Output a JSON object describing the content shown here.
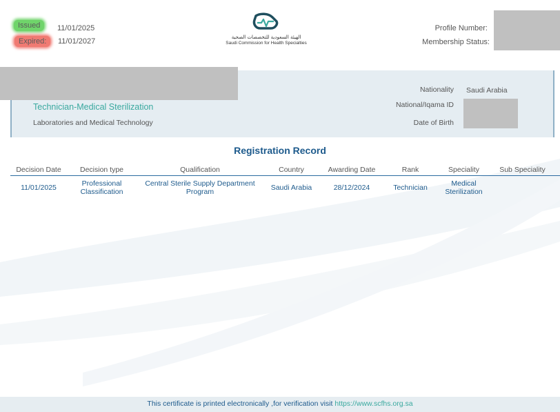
{
  "header": {
    "issued_label": "Issued",
    "issued_date": "11/01/2025",
    "expired_label": "Expired:",
    "expired_date": "11/01/2027",
    "org_name_ar": "الهيئة السعودية للتخصصات الصحية",
    "org_name_en": "Saudi Commission for Health Specialties",
    "profile_number_label": "Profile Number:",
    "membership_status_label": "Membership Status:"
  },
  "profile": {
    "specialty_title": "Technician-Medical Sterilization",
    "specialty_category": "Laboratories and Medical Technology",
    "nationality_label": "Nationality",
    "nationality_value": "Saudi Arabia",
    "id_label": "National/Iqama ID",
    "dob_label": "Date of Birth"
  },
  "registration": {
    "title": "Registration Record",
    "columns": [
      "Decision Date",
      "Decision type",
      "Qualification",
      "Country",
      "Awarding Date",
      "Rank",
      "Speciality",
      "Sub Speciality"
    ],
    "rows": [
      {
        "decision_date": "11/01/2025",
        "decision_type_l1": "Professional",
        "decision_type_l2": "Classification",
        "qualification_l1": "Central Sterile Supply Department",
        "qualification_l2": "Program",
        "country": "Saudi Arabia",
        "awarding_date": "28/12/2024",
        "rank": "Technician",
        "speciality_l1": "Medical",
        "speciality_l2": "Sterilization",
        "sub_speciality": ""
      }
    ]
  },
  "footer": {
    "text": "This certificate is printed electronically ,for verification visit ",
    "link": "https://www.scfhs.org.sa"
  },
  "colors": {
    "accent_teal": "#3aa99f",
    "accent_blue": "#1d5a8c",
    "panel_bg": "#e5edf2",
    "issued_highlight": "#6fd46a",
    "expired_highlight": "#f07a72"
  }
}
